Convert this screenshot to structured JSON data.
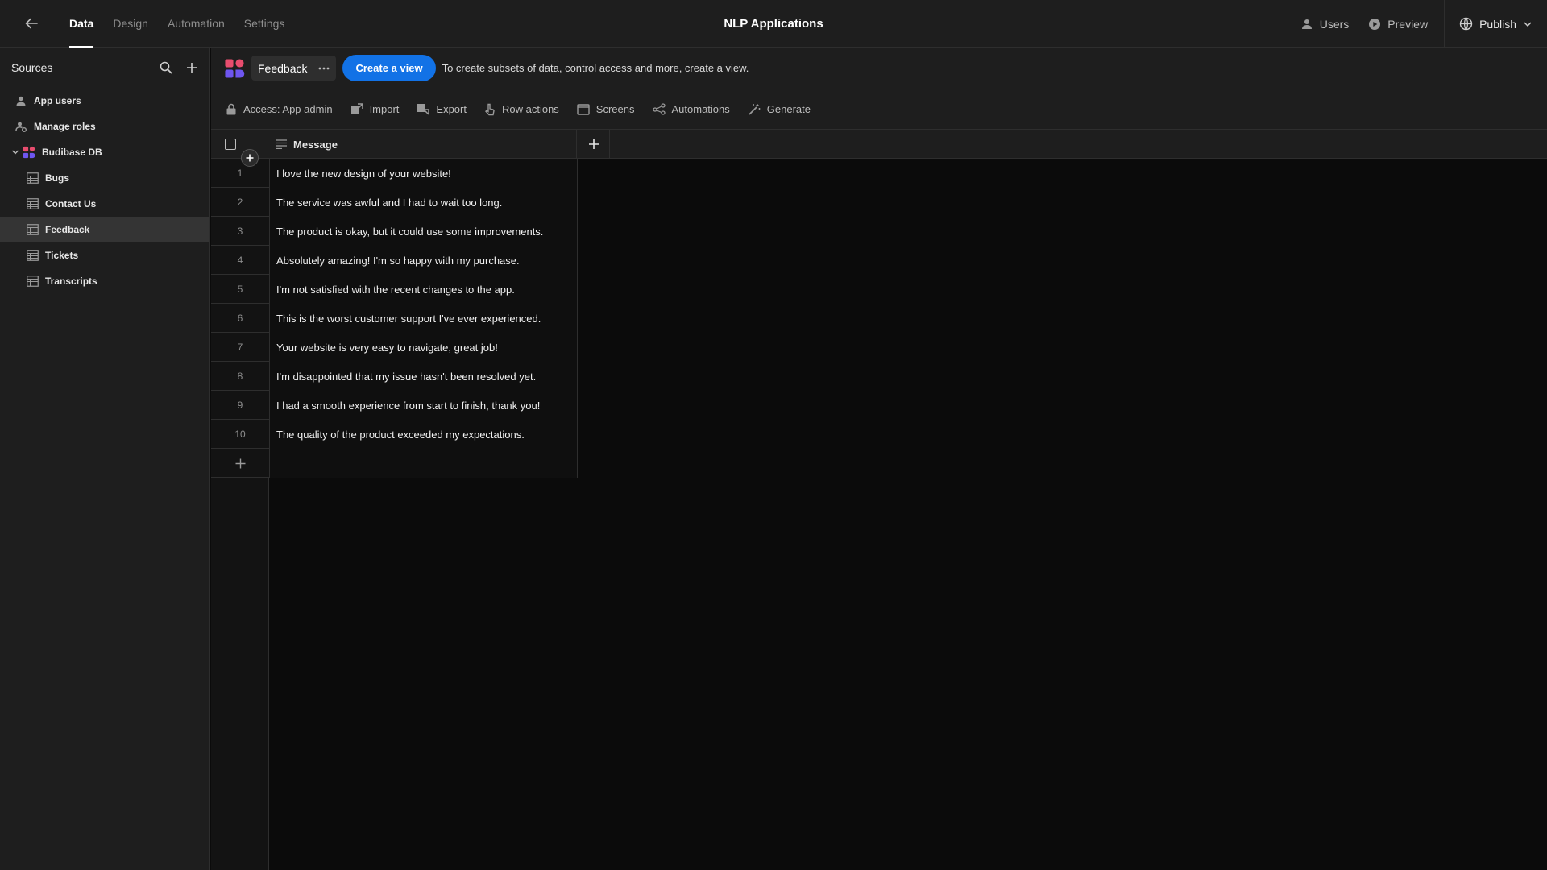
{
  "topbar": {
    "tabs": [
      {
        "label": "Data",
        "active": true
      },
      {
        "label": "Design",
        "active": false
      },
      {
        "label": "Automation",
        "active": false
      },
      {
        "label": "Settings",
        "active": false
      }
    ],
    "app_title": "NLP Applications",
    "users_label": "Users",
    "preview_label": "Preview",
    "publish_label": "Publish"
  },
  "sidebar": {
    "title": "Sources",
    "items": [
      {
        "label": "App users",
        "icon": "user-icon"
      },
      {
        "label": "Manage roles",
        "icon": "roles-icon"
      },
      {
        "label": "Budibase DB",
        "icon": "budibase-logo-icon"
      },
      {
        "label": "Bugs",
        "icon": "table-icon"
      },
      {
        "label": "Contact Us",
        "icon": "table-icon"
      },
      {
        "label": "Feedback",
        "icon": "table-icon",
        "selected": true
      },
      {
        "label": "Tickets",
        "icon": "table-icon"
      },
      {
        "label": "Transcripts",
        "icon": "table-icon"
      }
    ]
  },
  "header": {
    "table_name": "Feedback",
    "create_view_label": "Create a view",
    "hint": "To create subsets of data, control access and more, create a view."
  },
  "toolbar": {
    "access": "Access: App admin",
    "import": "Import",
    "export": "Export",
    "row_actions": "Row actions",
    "screens": "Screens",
    "automations": "Automations",
    "generate": "Generate"
  },
  "grid": {
    "column": "Message",
    "rows": [
      {
        "n": "1",
        "message": "I love the new design of your website!"
      },
      {
        "n": "2",
        "message": "The service was awful and I had to wait too long."
      },
      {
        "n": "3",
        "message": "The product is okay, but it could use some improvements."
      },
      {
        "n": "4",
        "message": "Absolutely amazing! I'm so happy with my purchase."
      },
      {
        "n": "5",
        "message": "I'm not satisfied with the recent changes to the app."
      },
      {
        "n": "6",
        "message": "This is the worst customer support I've ever experienced."
      },
      {
        "n": "7",
        "message": "Your website is very easy to navigate, great job!"
      },
      {
        "n": "8",
        "message": "I'm disappointed that my issue hasn't been resolved yet."
      },
      {
        "n": "9",
        "message": "I had a smooth experience from start to finish, thank you!"
      },
      {
        "n": "10",
        "message": "The quality of the product exceeded my expectations."
      }
    ]
  },
  "colors": {
    "accent": "#1272e6",
    "background": "#0b0b0b",
    "panel": "#1e1e1e",
    "selected": "#343434"
  }
}
